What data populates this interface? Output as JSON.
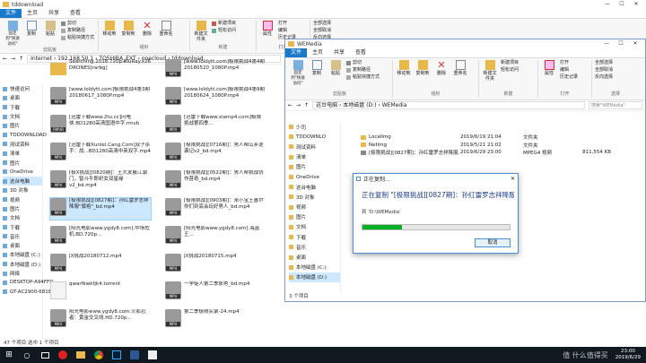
{
  "left_window": {
    "title": "tddownload",
    "tabs": [
      "文件",
      "主页",
      "共享",
      "查看"
    ],
    "ribbon": {
      "pin_quick": "固定到\"快速访问\"",
      "copy": "复制",
      "paste": "粘贴",
      "cut": "剪切",
      "copy_path": "复制路径",
      "paste_shortcut": "粘贴快捷方式",
      "move_to": "移动到",
      "copy_to": "复制到",
      "delete": "删除",
      "rename": "重命名",
      "new_folder": "新建文件夹",
      "new_item": "新建项目",
      "easy_access": "轻松访问",
      "properties": "属性",
      "open": "打开",
      "edit": "编辑",
      "history": "历史记录",
      "select_all": "全部选择",
      "select_none": "全部取消",
      "invert": "反向选择",
      "group_clipboard": "剪贴板",
      "group_organize": "组织",
      "group_new": "新建",
      "group_open": "打开"
    },
    "address": "Internet › 192.168.50.1 › TOSHIBA_EXT › onecloud › tddownload",
    "nav": [
      {
        "label": "快速访问",
        "sel": false
      },
      {
        "label": "桌面",
        "sel": false
      },
      {
        "label": "下载",
        "sel": false
      },
      {
        "label": "文档",
        "sel": false
      },
      {
        "label": "图片",
        "sel": false
      },
      {
        "label": "TDDOWNLOAD",
        "sel": false
      },
      {
        "label": "测试资料",
        "sel": false
      },
      {
        "label": "清单",
        "sel": false
      },
      {
        "label": "图片",
        "sel": false
      },
      {
        "label": "OneDrive",
        "sel": false
      },
      {
        "label": "这台电脑",
        "sel": true
      },
      {
        "label": "3D 对象",
        "sel": false
      },
      {
        "label": "视频",
        "sel": false
      },
      {
        "label": "图片",
        "sel": false
      },
      {
        "label": "文档",
        "sel": false
      },
      {
        "label": "下载",
        "sel": false
      },
      {
        "label": "音乐",
        "sel": false
      },
      {
        "label": "桌面",
        "sel": false
      },
      {
        "label": "本地磁盘 (C:)",
        "sel": false
      },
      {
        "label": "本地磁盘 (D:)",
        "sel": false
      },
      {
        "label": "网络",
        "sel": false
      },
      {
        "label": "DESKTOP-A94FFD",
        "sel": false
      },
      {
        "label": "GT-AC2900-6818",
        "sel": false
      }
    ],
    "files": [
      {
        "name": "SearchIng.2018.720p.BluRay.x264-DRONES[rarbg]",
        "type": "folder"
      },
      {
        "name": "[www.loldytt.com]极限挑战4第4期20180520_1080P.mp4",
        "type": "MP4"
      },
      {
        "name": "[www.loldytt.com]极限挑战4第3期20180617_1080P.mp4",
        "type": "MP4"
      },
      {
        "name": "[www.loldytt.com]极限挑战4第9期20180624_1080P.mp4",
        "type": "MP4"
      },
      {
        "name": "[迅雷下载www.2tu.cc]闪电侠.BD1280高清国语中字.rmvb",
        "type": "RMVB"
      },
      {
        "name": "[迅雷下载www.xiamp4.com]极限挑战第四季...",
        "type": "MP4"
      },
      {
        "name": "[迅雷下载Xunlei.Cang.Com]双子杀手：战...BD1280高清中英双字.mp4",
        "type": "MP4"
      },
      {
        "name": "[极限挑战][0716期]：男人帮山乡逆袭记v2_bd.mp4",
        "type": "MP4"
      },
      {
        "name": "[极X挑战][0820期]：王大发展江湖门，智斗牛郎织女双星缘v2_bd.mp4",
        "type": "MP4"
      },
      {
        "name": "[极限挑战][0522期]：男人帮挑战伪作甚奇_bd.mp4",
        "type": "MP4"
      },
      {
        "name": "[极限挑战][0827期]：孙红雷罗志祥降服\"旗袍\"_bd.mp4",
        "type": "MP4",
        "sel": true
      },
      {
        "name": "[极限挑战][0903期]：米小宝王善尔你们到底会玩好男人_bd.mp4",
        "type": "MP4"
      },
      {
        "name": "[阳光电影www.ygdy8.com].中场危机.BD.720p...",
        "type": "MP4"
      },
      {
        "name": "[阳光电影www.ygdy8.com].海盗王...",
        "type": "MP4"
      },
      {
        "name": "JX挑战20180712.mp4",
        "type": "MP4"
      },
      {
        "name": "JX挑战20180715.mp4",
        "type": "MP4"
      },
      {
        "name": "qwarfkwkfjk4.torrent",
        "type": "file"
      },
      {
        "name": "一学徒人第二季那秀_bd.mp4",
        "type": "MP4"
      },
      {
        "name": "阳光电影www.ygdy8.com.火影忍者：黄金交叉线.HD.720p...",
        "type": "MKV"
      },
      {
        "name": "第二季极限实录-24.mp4",
        "type": "MP4"
      }
    ],
    "status": "47 个项目    选中 1 个项目"
  },
  "right_window": {
    "title": "WEMedia",
    "tabs": [
      "文件",
      "主页",
      "共享",
      "查看"
    ],
    "ribbon": {
      "pin_quick": "固定到\"快速访问\"",
      "copy": "复制",
      "paste": "粘贴",
      "cut": "剪切",
      "copy_path": "复制路径",
      "paste_shortcut": "粘贴快捷方式",
      "move_to": "移动到",
      "copy_to": "复制到",
      "delete": "删除",
      "rename": "重命名",
      "new_folder": "新建文件夹",
      "new_item": "新建项目",
      "easy_access": "轻松访问",
      "properties": "属性",
      "open": "打开",
      "edit": "编辑",
      "history": "历史记录",
      "select_all": "全部选择",
      "select_none": "全部取消",
      "invert": "反向选择",
      "group_clipboard": "剪贴板",
      "group_organize": "组织",
      "group_new": "新建",
      "group_open": "打开",
      "group_select": "选择"
    },
    "address": "这台电脑 › 本地磁盘 (D:) › WEMedia",
    "search_placeholder": "搜索\"WEMedia\"",
    "nav": [
      {
        "label": "少司"
      },
      {
        "label": "TDDOWNLO"
      },
      {
        "label": "测试资料"
      },
      {
        "label": "清单"
      },
      {
        "label": "图片"
      },
      {
        "label": "OneDrive"
      },
      {
        "label": "这台电脑"
      },
      {
        "label": "3D 对象"
      },
      {
        "label": "视频"
      },
      {
        "label": "图片"
      },
      {
        "label": "文档"
      },
      {
        "label": "下载"
      },
      {
        "label": "音乐"
      },
      {
        "label": "桌面"
      },
      {
        "label": "本地磁盘 (C:)"
      },
      {
        "label": "本地磁盘 (D:)",
        "sel": true
      }
    ],
    "rows": [
      {
        "name": "LocalImg",
        "date": "2019/6/19 21:04",
        "type": "文件夹",
        "size": ""
      },
      {
        "name": "Netimg",
        "date": "2019/5/21 21:02",
        "type": "文件夹",
        "size": ""
      },
      {
        "name": "[极限挑战][0827期]：孙红雷罗志祥降服...",
        "date": "2019/6/29 23:00",
        "type": "MPEG4 视频",
        "size": "811,554 KB"
      }
    ],
    "status": "3 个项目"
  },
  "copy_dialog": {
    "title": "正在复制...",
    "heading": "正在复制 \"[极限挑战][0827期]：孙红雷罗志祥降服\" ...",
    "to_label": "到 'D:\\WEMedia'",
    "cancel": "取消",
    "progress": 0.27
  },
  "taskbar": {
    "time": "23:00",
    "date": "2019/6/29",
    "watermark": "值 什么值得买"
  },
  "colors": {
    "accent": "#1979ca",
    "selection": "#cce8ff",
    "progress": "#06b025",
    "taskbar": "#101820"
  }
}
